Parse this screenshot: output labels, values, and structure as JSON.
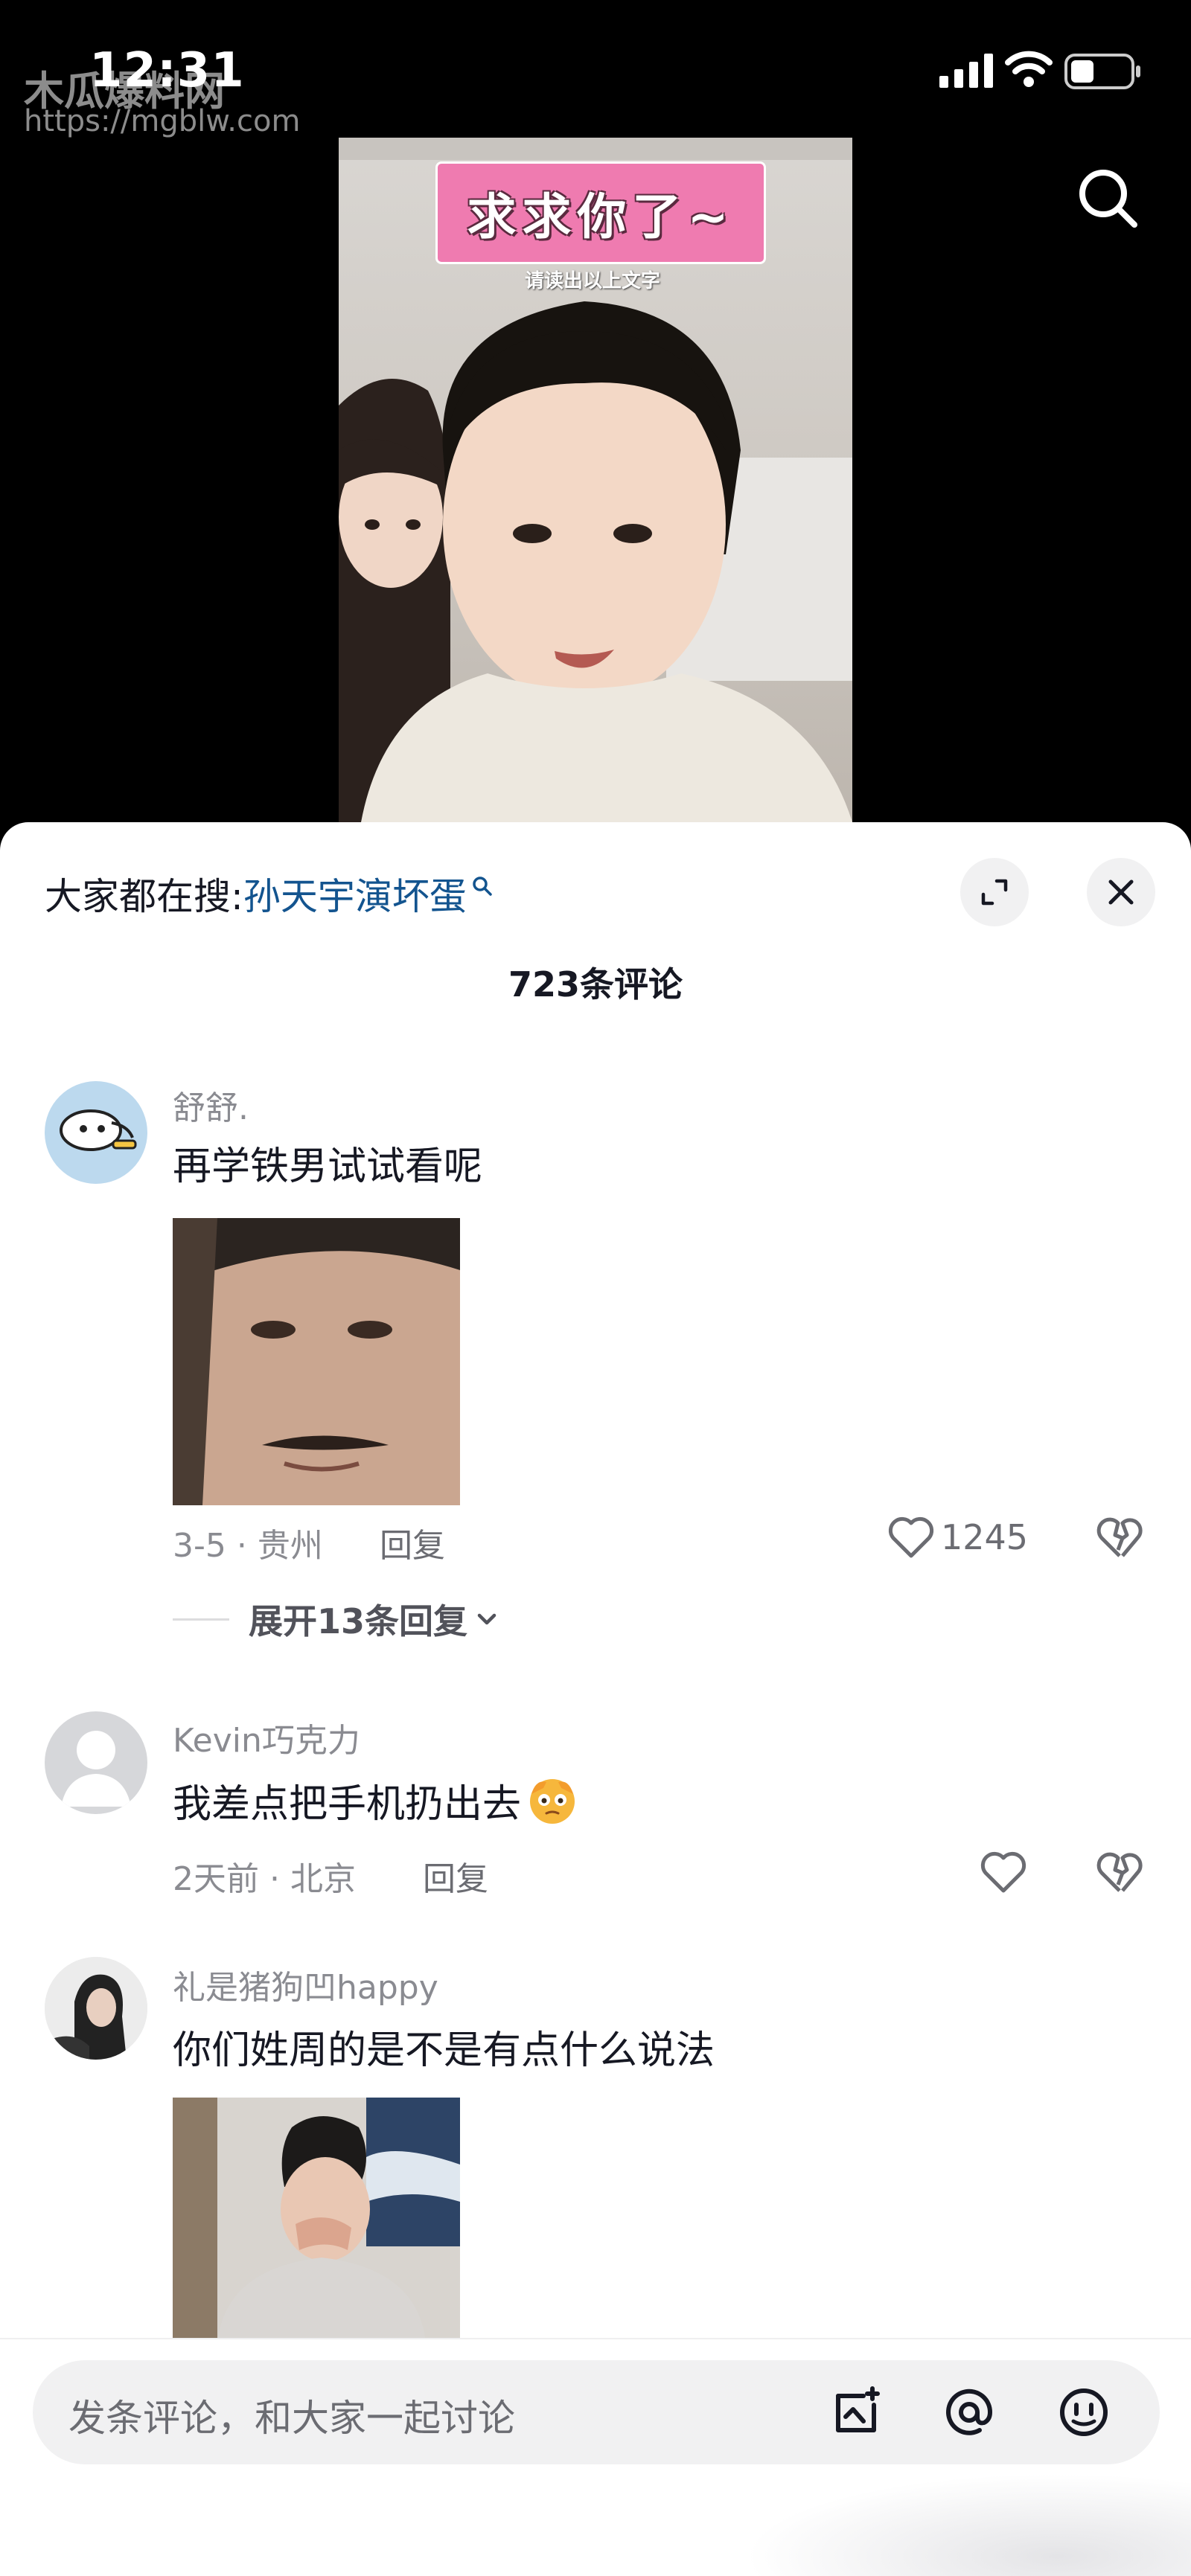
{
  "status_bar": {
    "time": "12:31",
    "watermark_name": "木瓜爆料网",
    "watermark_url": "https://mgblw.com"
  },
  "video": {
    "caption": "求求你了~",
    "subcaption": "请读出以上文字"
  },
  "sheet": {
    "search_hint_prefix": "大家都在搜:",
    "search_hint_query": "孙天宇演坏蛋",
    "comment_count": "723条评论"
  },
  "comments": [
    {
      "username": "舒舒.",
      "text": "再学铁男试试看呢",
      "date_location": "3-5 · 贵州",
      "reply_label": "回复",
      "likes": "1245",
      "expand_replies": "展开13条回复",
      "has_image": true
    },
    {
      "username": "Kevin巧克力",
      "text": "我差点把手机扔出去",
      "emoji": "flushed-face",
      "date_location": "2天前 · 北京",
      "reply_label": "回复",
      "likes": ""
    },
    {
      "username": "礼是猪狗凹happy",
      "text": "你们姓周的是不是有点什么说法",
      "has_image": true
    }
  ],
  "composer": {
    "placeholder": "发条评论，和大家一起讨论",
    "icons": [
      "image-icon",
      "at-icon",
      "emoji-icon"
    ]
  },
  "colors": {
    "background": "#000000",
    "sheet": "#ffffff",
    "link_blue": "#13548f",
    "muted_text": "#8a8b91",
    "caption_pink": "#ef7bb0"
  }
}
